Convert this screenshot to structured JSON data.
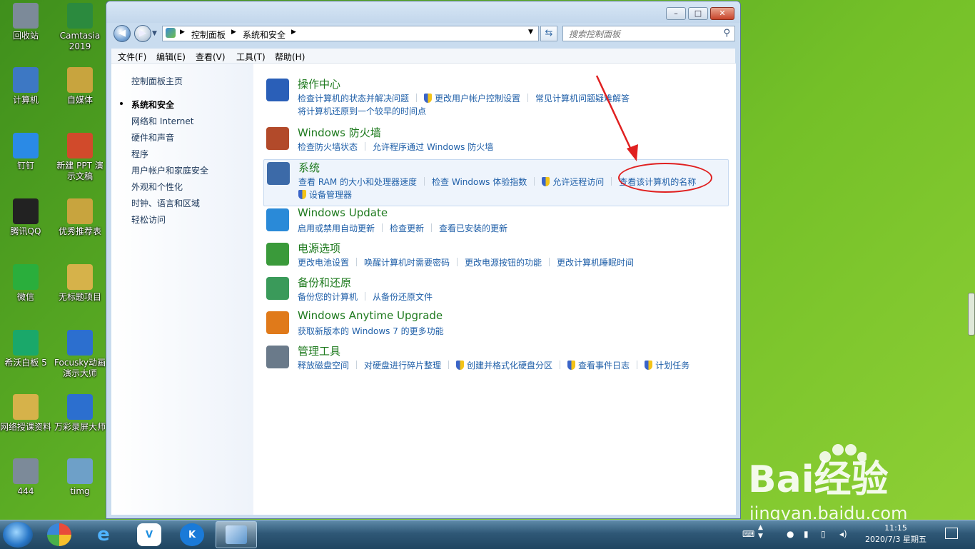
{
  "desktop": {
    "icons": [
      {
        "label": "回收站",
        "color": "#7c8a99"
      },
      {
        "label": "Camtasia 2019",
        "color": "#2b8a3e"
      },
      {
        "label": "计算机",
        "color": "#3d78c4"
      },
      {
        "label": "自媒体",
        "color": "#c8a43e"
      },
      {
        "label": "钉钉",
        "color": "#2a8ae6"
      },
      {
        "label": "新建 PPT 演示文稿",
        "color": "#d14a2b"
      },
      {
        "label": "腾讯QQ",
        "color": "#222222"
      },
      {
        "label": "优秀推荐表",
        "color": "#c8a43e"
      },
      {
        "label": "微信",
        "color": "#2aae3c"
      },
      {
        "label": "无标题项目",
        "color": "#d6b24a"
      },
      {
        "label": "希沃白板 5",
        "color": "#1aa86a"
      },
      {
        "label": "Focusky动画演示大师",
        "color": "#2c6fcf"
      },
      {
        "label": "网络授课资料",
        "color": "#d6b24a"
      },
      {
        "label": "万彩录屏大师",
        "color": "#2c6fcf"
      },
      {
        "label": "444",
        "color": "#7c8a99"
      },
      {
        "label": "timg",
        "color": "#6ea0c8"
      }
    ]
  },
  "window": {
    "controls": {
      "minimize": "–",
      "maximize": "□",
      "close": "✕"
    },
    "address": {
      "root_icon": "control-panel-icon",
      "crumbs": [
        "控制面板",
        "系统和安全"
      ]
    },
    "search": {
      "placeholder": "搜索控制面板"
    },
    "menu": [
      "文件(F)",
      "编辑(E)",
      "查看(V)",
      "工具(T)",
      "帮助(H)"
    ],
    "left_pane": {
      "home": "控制面板主页",
      "items": [
        "系统和安全",
        "网络和 Internet",
        "硬件和声音",
        "程序",
        "用户帐户和家庭安全",
        "外观和个性化",
        "时钟、语言和区域",
        "轻松访问"
      ]
    },
    "categories": [
      {
        "title": "操作中心",
        "icon": "flag-icon",
        "lines": [
          [
            "检查计算机的状态并解决问题",
            "更改用户帐户控制设置",
            "常见计算机问题疑难解答"
          ],
          [
            "将计算机还原到一个较早的时间点"
          ]
        ]
      },
      {
        "title": "Windows 防火墙",
        "icon": "firewall-icon",
        "lines": [
          [
            "检查防火墙状态",
            "允许程序通过 Windows 防火墙"
          ]
        ]
      },
      {
        "title": "系统",
        "icon": "computer-icon",
        "lines": [
          [
            "查看 RAM 的大小和处理器速度",
            "检查 Windows 体验指数",
            "允许远程访问",
            "查看该计算机的名称"
          ],
          [
            "设备管理器"
          ]
        ]
      },
      {
        "title": "Windows Update",
        "icon": "update-icon",
        "lines": [
          [
            "启用或禁用自动更新",
            "检查更新",
            "查看已安装的更新"
          ]
        ]
      },
      {
        "title": "电源选项",
        "icon": "power-icon",
        "lines": [
          [
            "更改电池设置",
            "唤醒计算机时需要密码",
            "更改电源按钮的功能",
            "更改计算机睡眠时间"
          ]
        ]
      },
      {
        "title": "备份和还原",
        "icon": "backup-icon",
        "lines": [
          [
            "备份您的计算机",
            "从备份还原文件"
          ]
        ]
      },
      {
        "title": "Windows Anytime Upgrade",
        "icon": "windows-logo-icon",
        "lines": [
          [
            "获取新版本的 Windows 7 的更多功能"
          ]
        ]
      },
      {
        "title": "管理工具",
        "icon": "admin-tools-icon",
        "lines": [
          [
            "释放磁盘空间",
            "对硬盘进行碎片整理",
            "创建并格式化硬盘分区",
            "查看事件日志",
            "计划任务"
          ]
        ]
      }
    ]
  },
  "taskbar": {
    "clock_time": "11:15",
    "clock_date": "2020/7/3 星期五"
  },
  "watermark": {
    "brand": "Bai经验",
    "url": "jingyan.baidu.com"
  }
}
